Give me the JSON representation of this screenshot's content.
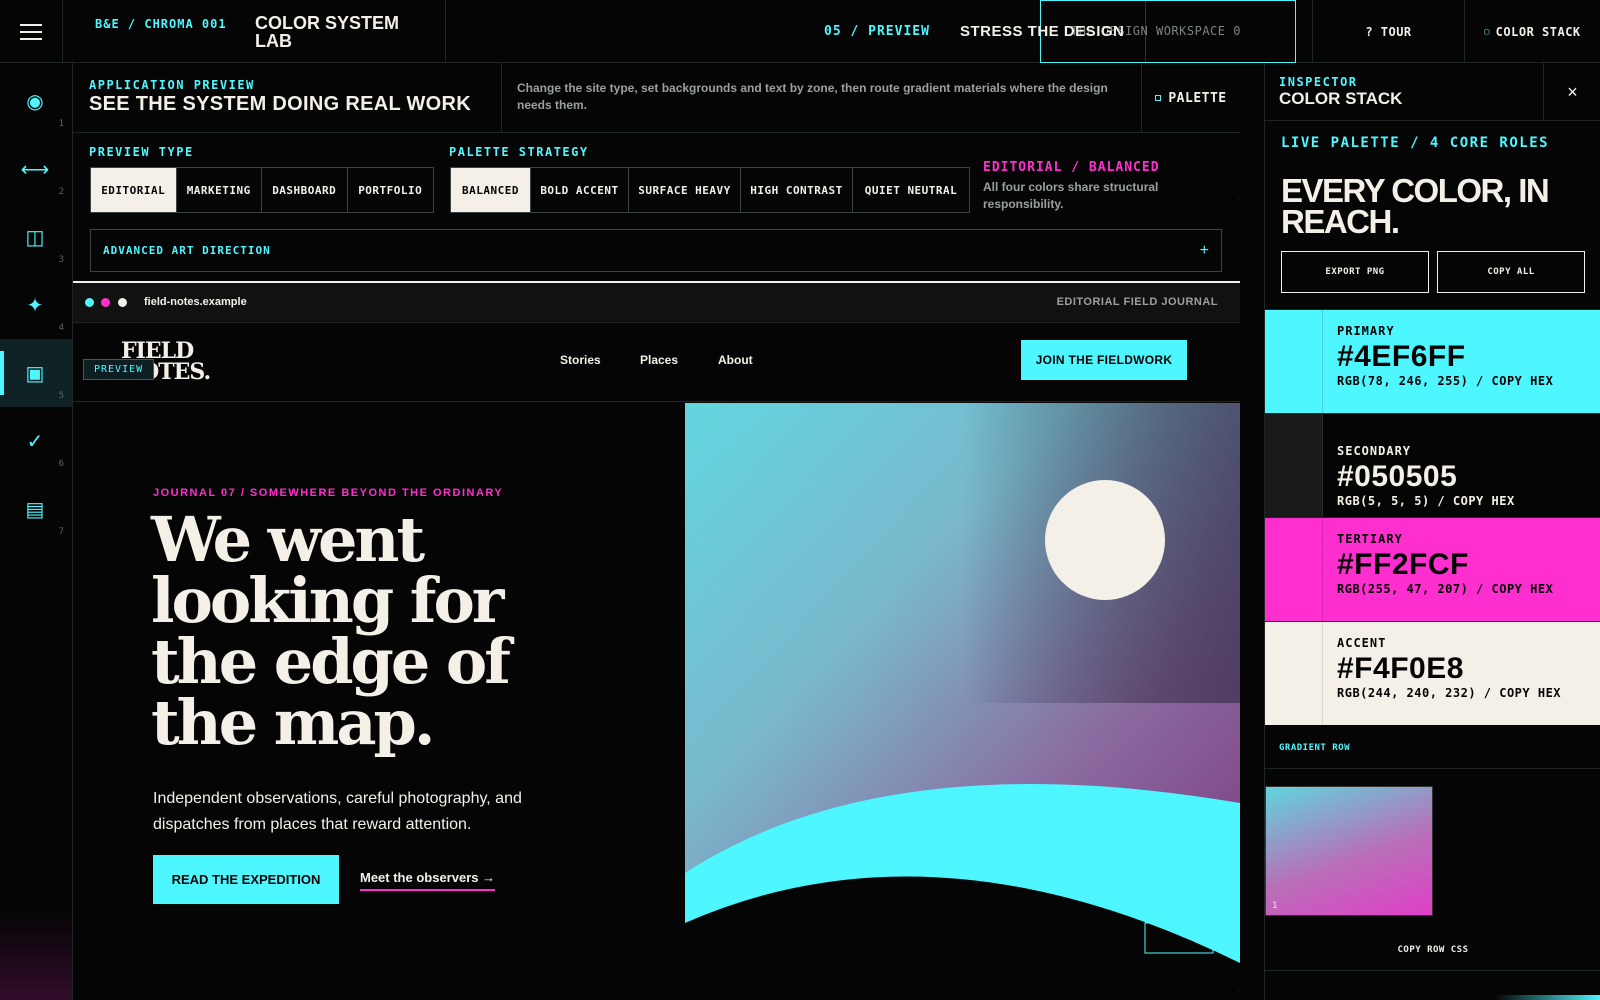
{
  "topbar": {
    "brand_code": "B&E / CHROMA 001",
    "brand_title": "COLOR SYSTEM LAB",
    "step_label": "05 / PREVIEW",
    "step_title": "STRESS THE DESIGN",
    "workspace_text": "THE DESIGN WORKSPACE 0",
    "tour_label": "? TOUR",
    "stack_label": "COLOR STACK"
  },
  "rail": {
    "items": [
      {
        "icon": "◉",
        "num": "1",
        "name": "target-icon"
      },
      {
        "icon": "⟷",
        "num": "2",
        "name": "arrows-icon"
      },
      {
        "icon": "◫",
        "num": "3",
        "name": "columns-icon"
      },
      {
        "icon": "✦",
        "num": "4",
        "name": "sparkle-icon"
      },
      {
        "icon": "▣",
        "num": "5",
        "name": "preview-icon"
      },
      {
        "icon": "✓",
        "num": "6",
        "name": "check-icon"
      },
      {
        "icon": "▤",
        "num": "7",
        "name": "list-icon"
      }
    ]
  },
  "app": {
    "eyebrow": "APPLICATION PREVIEW",
    "title": "SEE THE SYSTEM DOING REAL WORK",
    "description": "Change the site type, set backgrounds and text by zone, then route gradient materials where the design needs them.",
    "palette_label": "PALETTE",
    "preview_type_label": "PREVIEW TYPE",
    "preview_types": [
      "EDITORIAL",
      "MARKETING",
      "DASHBOARD",
      "PORTFOLIO"
    ],
    "palette_strategy_label": "PALETTE STRATEGY",
    "strategies": [
      "BALANCED",
      "BOLD ACCENT",
      "SURFACE HEAVY",
      "HIGH CONTRAST",
      "QUIET NEUTRAL"
    ],
    "strategy_tag": "EDITORIAL / BALANCED",
    "strategy_desc": "All four colors share structural responsibility.",
    "advanced_label": "ADVANCED ART DIRECTION",
    "advanced_icon": "+"
  },
  "browser": {
    "url": "field-notes.example",
    "site_label": "EDITORIAL FIELD JOURNAL",
    "logo": "FIELD NOTES.",
    "preview_chip": "PREVIEW",
    "nav": [
      "Stories",
      "Places",
      "About"
    ],
    "join": "JOIN THE FIELDWORK",
    "hero_eyebrow": "JOURNAL 07 / SOMEWHERE BEYOND THE ORDINARY",
    "hero_title": "We went looking for the edge of the map.",
    "hero_body": "Independent observations, careful photography, and dispatches from places that reward attention.",
    "hero_cta": "READ THE EXPEDITION",
    "hero_link": "Meet the observers →"
  },
  "inspector": {
    "eyebrow": "INSPECTOR",
    "title": "COLOR STACK",
    "close": "×",
    "live_label": "LIVE PALETTE / 4 CORE ROLES",
    "hero": "EVERY COLOR, IN REACH.",
    "export": "EXPORT PNG",
    "copy_all": "COPY ALL",
    "swatches": [
      {
        "role": "PRIMARY",
        "hex": "#4EF6FF",
        "rgb": "RGB(78, 246, 255) / COPY HEX"
      },
      {
        "role": "SECONDARY",
        "hex": "#050505",
        "rgb": "RGB(5, 5, 5) / COPY HEX"
      },
      {
        "role": "TERTIARY",
        "hex": "#FF2FCF",
        "rgb": "RGB(255, 47, 207) / COPY HEX"
      },
      {
        "role": "ACCENT",
        "hex": "#F4F0E8",
        "rgb": "RGB(244, 240, 232) / COPY HEX"
      }
    ],
    "gradient_label": "GRADIENT ROW",
    "gradient_index": "1",
    "copy_row_css": "COPY ROW CSS"
  },
  "colors": {
    "primary": "#4EF6FF",
    "secondary": "#050505",
    "tertiary": "#FF2FCF",
    "accent": "#F4F0E8"
  }
}
